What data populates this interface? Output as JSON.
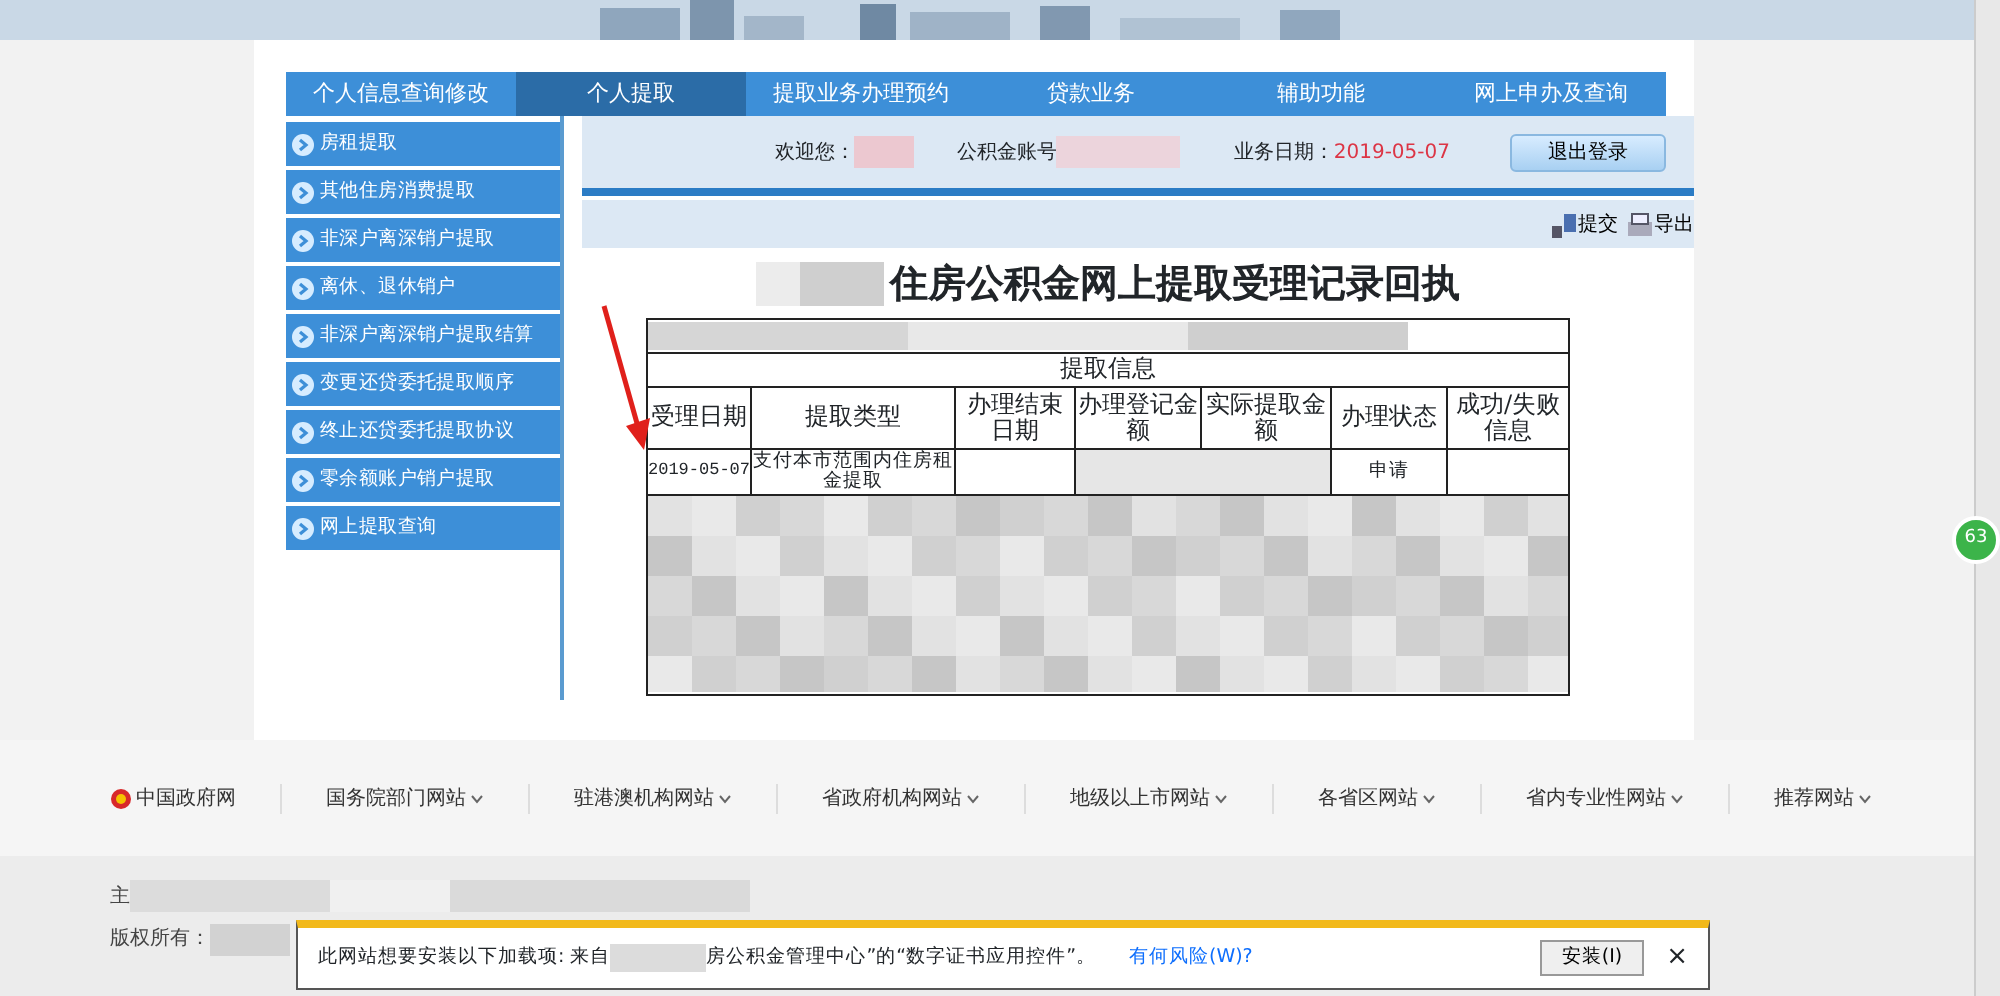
{
  "nav": [
    {
      "label": "个人信息查询修改",
      "selected": false
    },
    {
      "label": "个人提取",
      "selected": true
    },
    {
      "label": "提取业务办理预约",
      "selected": false
    },
    {
      "label": "贷款业务",
      "selected": false
    },
    {
      "label": "辅助功能",
      "selected": false
    },
    {
      "label": "网上申办及查询",
      "selected": false
    }
  ],
  "sidebar": [
    "房租提取",
    "其他住房消费提取",
    "非深户离深销户提取",
    "离休、退休销户",
    "非深户离深销户提取结算",
    "变更还贷委托提取顺序",
    "终止还贷委托提取协议",
    "零余额账户销户提取",
    "网上提取查询"
  ],
  "user_bar": {
    "welcome_label": "欢迎您：",
    "account_label": "公积金账号",
    "date_label": "业务日期：",
    "date": "2019-05-07",
    "logout": "退出登录"
  },
  "toolbar": [
    "提交",
    "导出"
  ],
  "document": {
    "title": "住房公积金网上提取受理记录回执",
    "section": "提取信息",
    "columns": [
      "受理日期",
      "提取类型",
      "办理结束日期",
      "办理登记金额",
      "实际提取金额",
      "办理状态",
      "成功/失败信息"
    ],
    "cells": [
      {
        "text": "2019-05-07",
        "redacted": false
      },
      {
        "text": "支付本市范围内住房租金提取",
        "redacted": false
      },
      {
        "redacted": false
      },
      {
        "redacted": true
      },
      {
        "redacted": true
      },
      {
        "text": "申请",
        "redacted": false
      },
      {
        "redacted": false
      }
    ]
  },
  "footer_links": [
    {
      "label": "中国政府网",
      "dropdown": false
    },
    {
      "label": "国务院部门网站",
      "dropdown": true
    },
    {
      "label": "驻港澳机构网站",
      "dropdown": true
    },
    {
      "label": "省政府机构网站",
      "dropdown": true
    },
    {
      "label": "地级以上市网站",
      "dropdown": true
    },
    {
      "label": "各省区网站",
      "dropdown": true
    },
    {
      "label": "省内专业性网站",
      "dropdown": true
    },
    {
      "label": "推荐网站",
      "dropdown": true
    }
  ],
  "footer_lines": [
    "主",
    "版权所有："
  ],
  "info_bar": {
    "message": "此网站想要安装以下加载项: 来自",
    "message_tail": "房公积金管理中心”的“数字证书应用控件”。",
    "link": "有何风险(W)?",
    "button": "安装(I)",
    "close": "×"
  },
  "side_badge": "63"
}
